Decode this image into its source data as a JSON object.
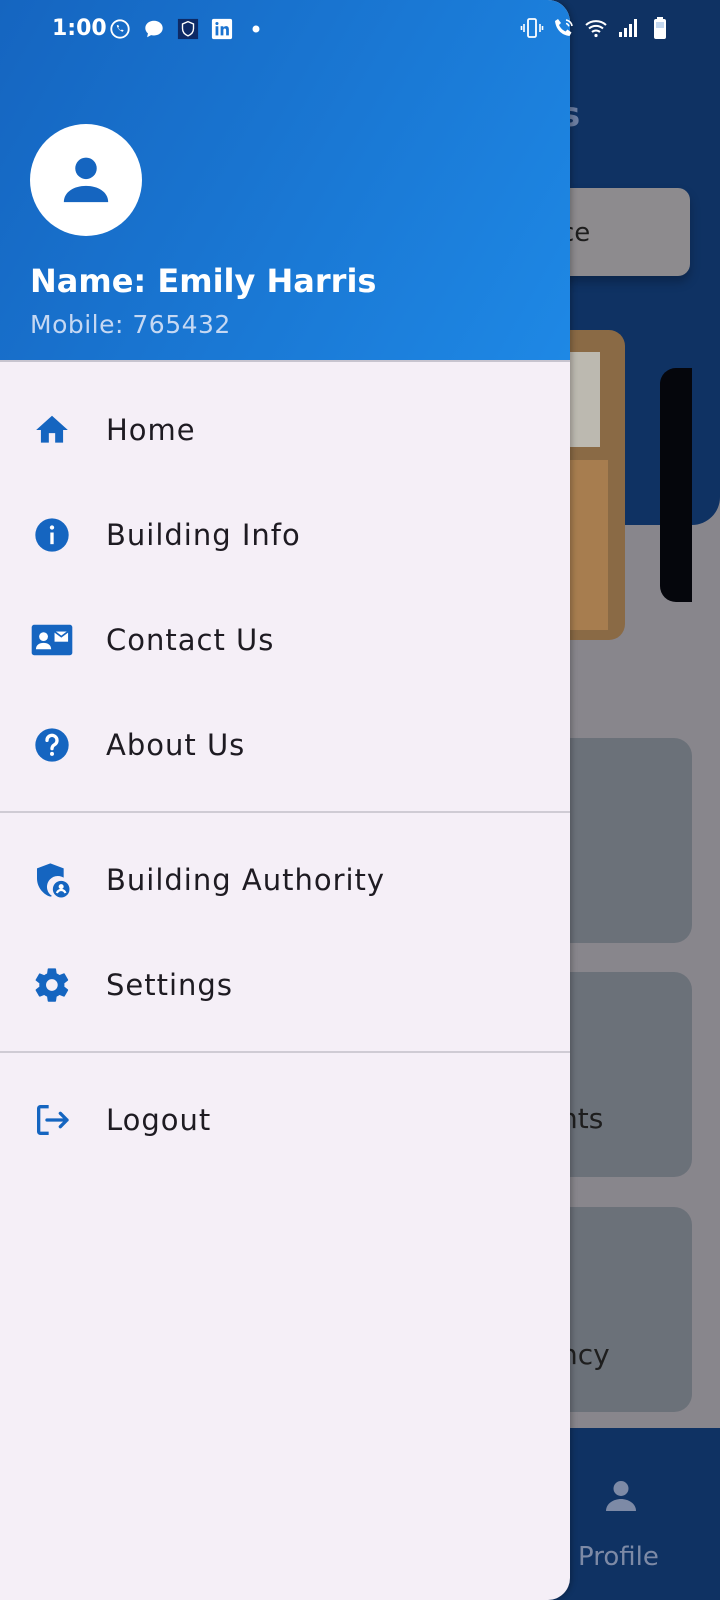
{
  "status_bar": {
    "time": "1:00"
  },
  "drawer": {
    "user_name": "Name: Emily Harris",
    "user_mobile": "Mobile: 765432",
    "menu_primary": [
      {
        "label": "Home",
        "icon": "home-icon"
      },
      {
        "label": "Building Info",
        "icon": "info-icon"
      },
      {
        "label": "Contact Us",
        "icon": "contact-card-icon"
      },
      {
        "label": "About Us",
        "icon": "help-icon"
      }
    ],
    "menu_secondary": [
      {
        "label": "Building Authority",
        "icon": "admin-shield-icon"
      },
      {
        "label": "Settings",
        "icon": "gear-icon"
      }
    ],
    "menu_tertiary": [
      {
        "label": "Logout",
        "icon": "logout-icon"
      }
    ]
  },
  "background": {
    "title_fragment": "s",
    "service_fragment": "ce",
    "card_fragments": [
      "nts",
      "ncy"
    ],
    "bottom_nav_label": "Profile"
  },
  "colors": {
    "accent": "#1565c0",
    "drawer_bg": "#f5eff7",
    "icon": "#1565c0"
  }
}
